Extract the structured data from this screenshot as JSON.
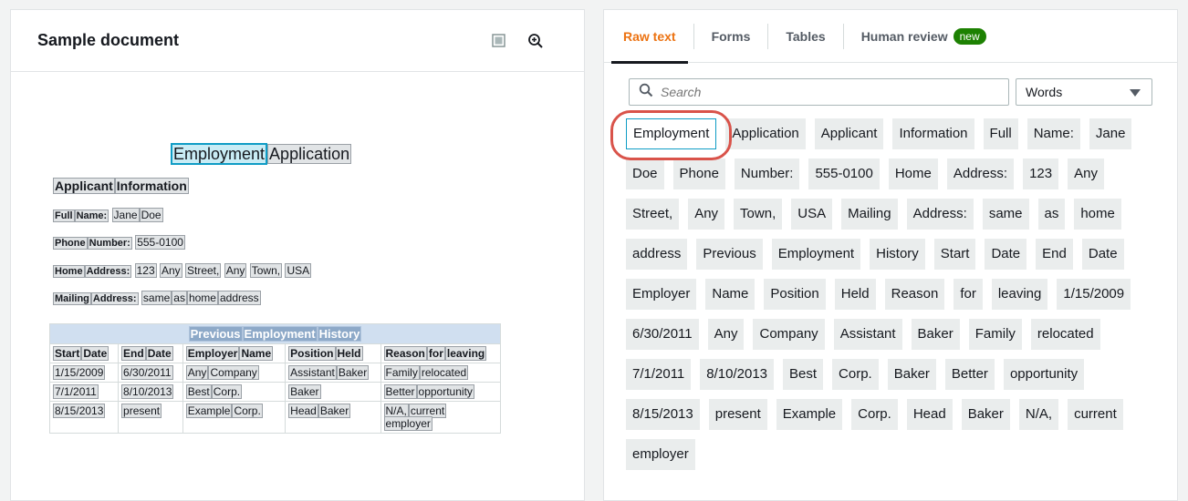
{
  "left_panel": {
    "title": "Sample document",
    "icons": [
      "document-view-icon",
      "zoom-in-icon"
    ]
  },
  "document": {
    "title_words": [
      "Employment",
      "Application"
    ],
    "section": [
      "Applicant",
      "Information"
    ],
    "full_name": {
      "label": [
        "Full",
        "Name:"
      ],
      "value": [
        "Jane",
        "Doe"
      ]
    },
    "phone": {
      "label": [
        "Phone",
        "Number:"
      ],
      "value": [
        "555-0100"
      ]
    },
    "home": {
      "label": [
        "Home",
        "Address:"
      ],
      "value": [
        "123",
        "Any",
        "Street,",
        "Any",
        "Town,",
        "USA"
      ]
    },
    "mailing": {
      "label": [
        "Mailing",
        "Address:"
      ],
      "value": [
        "same",
        "as",
        "home",
        "address"
      ]
    },
    "table": {
      "caption": [
        "Previous",
        "Employment",
        "History"
      ],
      "headers": [
        [
          "Start",
          "Date"
        ],
        [
          "End",
          "Date"
        ],
        [
          "Employer",
          "Name"
        ],
        [
          "Position",
          "Held"
        ],
        [
          "Reason",
          "for",
          "leaving"
        ]
      ],
      "rows": [
        [
          [
            "1/15/2009"
          ],
          [
            "6/30/2011"
          ],
          [
            "Any",
            "Company"
          ],
          [
            "Assistant",
            "Baker"
          ],
          [
            "Family",
            "relocated"
          ]
        ],
        [
          [
            "7/1/2011"
          ],
          [
            "8/10/2013"
          ],
          [
            "Best",
            "Corp."
          ],
          [
            "Baker"
          ],
          [
            "Better",
            "opportunity"
          ]
        ],
        [
          [
            "8/15/2013"
          ],
          [
            "present"
          ],
          [
            "Example",
            "Corp."
          ],
          [
            "Head",
            "Baker"
          ],
          [
            "N/A,",
            "current",
            "employer"
          ]
        ]
      ]
    }
  },
  "right_panel": {
    "tabs": [
      {
        "label": "Raw text",
        "active": true
      },
      {
        "label": "Forms",
        "active": false
      },
      {
        "label": "Tables",
        "active": false
      },
      {
        "label": "Human review",
        "active": false,
        "badge": "new"
      }
    ],
    "search": {
      "placeholder": "Search"
    },
    "granularity": {
      "selected": "Words"
    },
    "words": [
      "Employment",
      "Application",
      "Applicant",
      "Information",
      "Full",
      "Name:",
      "Jane",
      "Doe",
      "Phone",
      "Number:",
      "555-0100",
      "Home",
      "Address:",
      "123",
      "Any",
      "Street,",
      "Any",
      "Town,",
      "USA",
      "Mailing",
      "Address:",
      "same",
      "as",
      "home",
      "address",
      "Previous",
      "Employment",
      "History",
      "Start",
      "Date",
      "End",
      "Date",
      "Employer",
      "Name",
      "Position",
      "Held",
      "Reason",
      "for",
      "leaving",
      "1/15/2009",
      "6/30/2011",
      "Any",
      "Company",
      "Assistant",
      "Baker",
      "Family",
      "relocated",
      "7/1/2011",
      "8/10/2013",
      "Best",
      "Corp.",
      "Baker",
      "Better",
      "opportunity",
      "8/15/2013",
      "present",
      "Example",
      "Corp.",
      "Head",
      "Baker",
      "N/A,",
      "current",
      "employer"
    ],
    "selected_word_index": 0
  },
  "colors": {
    "accent": "#ec7211",
    "selection": "#0f9cc5",
    "highlight_ring": "#d9534a",
    "badge": "#1d8102"
  }
}
